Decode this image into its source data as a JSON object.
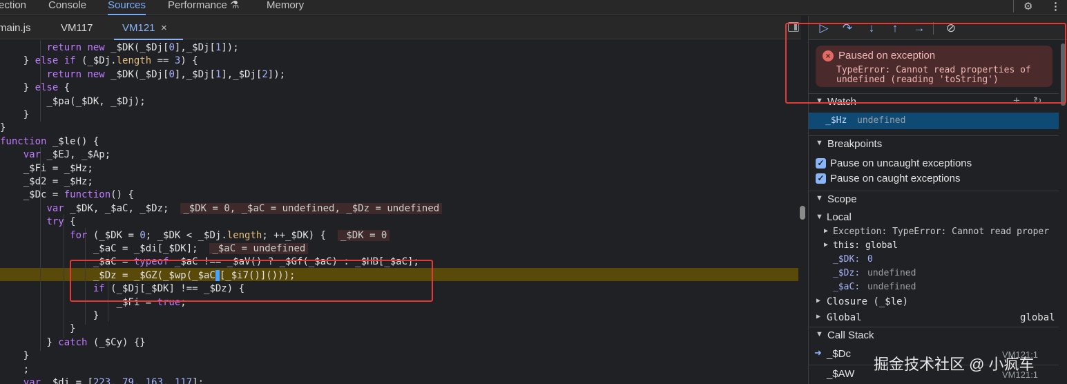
{
  "top_tabs": [
    "ection",
    "Console",
    "Sources",
    "Performance",
    "Memory"
  ],
  "active_top_tab": "Sources",
  "file_tabs": [
    "main.js",
    "VM117",
    "VM121"
  ],
  "active_file_tab": "VM121",
  "close_glyph": "×",
  "code_lines": [
    {
      "indent": 0,
      "parts": [
        [
          "",
          "        "
        ],
        [
          "kw",
          "return new "
        ],
        [
          "",
          "_$DK(_$Dj["
        ],
        [
          "num",
          "0"
        ],
        [
          "",
          "],_$Dj["
        ],
        [
          "num",
          "1"
        ],
        [
          "",
          "]);"
        ]
      ]
    },
    {
      "indent": 0,
      "parts": [
        [
          "",
          "    } "
        ],
        [
          "kw",
          "else if "
        ],
        [
          "",
          "(_$Dj."
        ],
        [
          "prop",
          "length"
        ],
        [
          "",
          " == "
        ],
        [
          "num",
          "3"
        ],
        [
          "",
          ") {"
        ]
      ]
    },
    {
      "indent": 0,
      "parts": [
        [
          "",
          "        "
        ],
        [
          "kw",
          "return new "
        ],
        [
          "",
          "_$DK(_$Dj["
        ],
        [
          "num",
          "0"
        ],
        [
          "",
          "],_$Dj["
        ],
        [
          "num",
          "1"
        ],
        [
          "",
          "],_$Dj["
        ],
        [
          "num",
          "2"
        ],
        [
          "",
          "]);"
        ]
      ]
    },
    {
      "indent": 0,
      "parts": [
        [
          "",
          "    } "
        ],
        [
          "kw",
          "else "
        ],
        [
          "",
          "{"
        ]
      ]
    },
    {
      "indent": 0,
      "parts": [
        [
          "",
          "        _$pa(_$DK, _$Dj);"
        ]
      ]
    },
    {
      "indent": 0,
      "parts": [
        [
          "",
          "    }"
        ]
      ]
    },
    {
      "indent": 0,
      "parts": [
        [
          "",
          "}"
        ]
      ]
    },
    {
      "indent": 0,
      "parts": [
        [
          "kw",
          "function "
        ],
        [
          "",
          "_$le() {"
        ]
      ]
    },
    {
      "indent": 0,
      "parts": [
        [
          "",
          "    "
        ],
        [
          "kw",
          "var "
        ],
        [
          "",
          "_$EJ, _$Ap;"
        ]
      ]
    },
    {
      "indent": 0,
      "parts": [
        [
          "",
          "    _$Fi = _$Hz;"
        ]
      ]
    },
    {
      "indent": 0,
      "parts": [
        [
          "",
          "    _$d2 = _$Hz;"
        ]
      ]
    },
    {
      "indent": 0,
      "parts": [
        [
          "",
          "    _$Dc = "
        ],
        [
          "kw",
          "function"
        ],
        [
          "",
          "() {"
        ]
      ]
    },
    {
      "indent": 0,
      "parts": [
        [
          "",
          "        "
        ],
        [
          "kw",
          "var "
        ],
        [
          "",
          "_$DK, _$aC, _$Dz;  "
        ],
        [
          "val",
          "_$DK = 0, _$aC = undefined, _$Dz = undefined"
        ]
      ]
    },
    {
      "indent": 0,
      "parts": [
        [
          "",
          "        "
        ],
        [
          "kw",
          "try "
        ],
        [
          "",
          "{"
        ]
      ]
    },
    {
      "indent": 0,
      "parts": [
        [
          "",
          "            "
        ],
        [
          "kw",
          "for "
        ],
        [
          "",
          "(_$DK = "
        ],
        [
          "num",
          "0"
        ],
        [
          "",
          "; _$DK < _$Dj."
        ],
        [
          "prop",
          "length"
        ],
        [
          "",
          "; ++_$DK) {  "
        ],
        [
          "val",
          "_$DK = 0"
        ]
      ]
    },
    {
      "indent": 0,
      "parts": [
        [
          "",
          "                _$aC = _$di[_$DK];  "
        ],
        [
          "val",
          "_$aC = undefined"
        ]
      ]
    },
    {
      "indent": 0,
      "parts": [
        [
          "",
          "                _$aC = "
        ],
        [
          "kw",
          "typeof "
        ],
        [
          "",
          "_$aC !== _$aV() ? _$Gf(_$aC) : _$HB[_$aC];"
        ]
      ]
    },
    {
      "indent": 0,
      "parts": [
        [
          "",
          "                _$Dz = _$GZ(_$wp(_$aC"
        ],
        [
          "cursor",
          ""
        ],
        [
          "",
          "[_$i7()]()));"
        ]
      ]
    },
    {
      "indent": 0,
      "parts": [
        [
          "",
          "                "
        ],
        [
          "kw",
          "if "
        ],
        [
          "",
          "(_$Dj[_$DK] !== _$Dz) {"
        ]
      ]
    },
    {
      "indent": 0,
      "parts": [
        [
          "",
          "                    _$Fi = "
        ],
        [
          "kw",
          "true"
        ],
        [
          "",
          ";"
        ]
      ]
    },
    {
      "indent": 0,
      "parts": [
        [
          "",
          "                }"
        ]
      ]
    },
    {
      "indent": 0,
      "parts": [
        [
          "",
          "            }"
        ]
      ]
    },
    {
      "indent": 0,
      "parts": [
        [
          "",
          "        } "
        ],
        [
          "kw",
          "catch "
        ],
        [
          "",
          "(_$Cy) {}"
        ]
      ]
    },
    {
      "indent": 0,
      "parts": [
        [
          "",
          "    }"
        ]
      ]
    },
    {
      "indent": 0,
      "parts": [
        [
          "",
          "    ;"
        ]
      ]
    },
    {
      "indent": 0,
      "parts": [
        [
          "",
          "    "
        ],
        [
          "kw",
          "var "
        ],
        [
          "",
          "_$di = ["
        ],
        [
          "num",
          "223"
        ],
        [
          "",
          ", "
        ],
        [
          "num",
          "79"
        ],
        [
          "",
          ", "
        ],
        [
          "num",
          "163"
        ],
        [
          "",
          ", "
        ],
        [
          "num",
          "117"
        ],
        [
          "",
          "];"
        ]
      ]
    }
  ],
  "exception": {
    "title": "Paused on exception",
    "message_line1": "TypeError: Cannot read properties of",
    "message_line2": "undefined (reading 'toString')"
  },
  "watch": {
    "label": "Watch",
    "add_glyph": "+",
    "refresh_glyph": "↻",
    "item_name": "_$Hz",
    "item_value": "undefined"
  },
  "breakpoints": {
    "label": "Breakpoints",
    "items": [
      "Pause on uncaught exceptions",
      "Pause on caught exceptions"
    ]
  },
  "scope": {
    "label": "Scope",
    "local_label": "Local",
    "exception_row": "Exception: TypeError: Cannot read proper",
    "this_row": "this: global",
    "vars": [
      {
        "name": "_$DK",
        "value": "0"
      },
      {
        "name": "_$Dz",
        "value": "undefined"
      },
      {
        "name": "_$aC",
        "value": "undefined"
      }
    ],
    "closure_label": "Closure (_$le)",
    "global_label": "Global",
    "global_value": "global"
  },
  "call_stack": {
    "label": "Call Stack",
    "frames": [
      {
        "name": "_$Dc",
        "location": "VM121:1"
      },
      {
        "name": "_$AW",
        "location": "VM121:1"
      }
    ]
  },
  "watermark": "掘金技术社区 @ 小疯车",
  "colors": {
    "accent": "#8ab4f8",
    "highlight_line": "#5a4a0a",
    "annotation_red": "#e53935"
  }
}
